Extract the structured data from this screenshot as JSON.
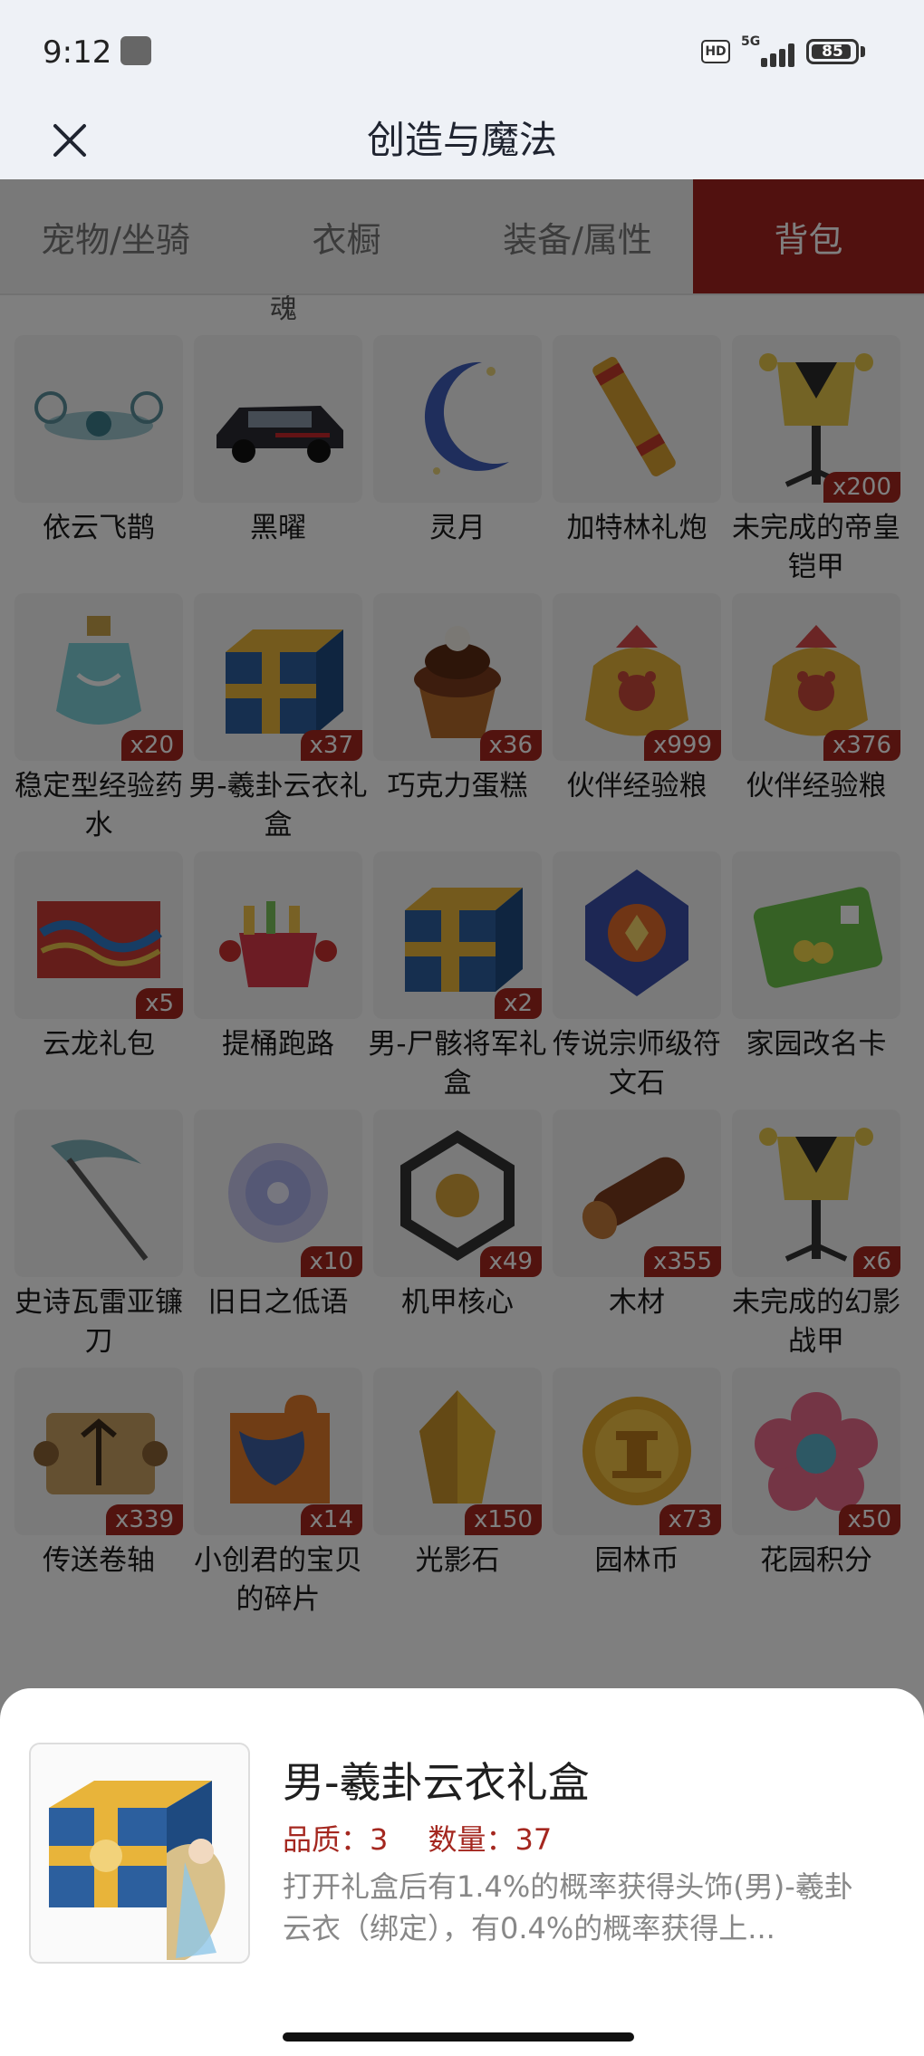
{
  "status": {
    "time": "9:12",
    "hd": "HD",
    "network": "5G",
    "battery": "85"
  },
  "header": {
    "title": "创造与魔法",
    "close_icon": "close-icon"
  },
  "tabs": [
    {
      "label": "宠物/坐骑",
      "active": false
    },
    {
      "label": "衣橱",
      "active": false
    },
    {
      "label": "装备/属性",
      "active": false
    },
    {
      "label": "背包",
      "active": true
    }
  ],
  "clipped_text": "魂",
  "items": [
    [
      {
        "name": "依云飞鹊",
        "badge": "",
        "icon": "drone-icon"
      },
      {
        "name": "黑曜",
        "badge": "",
        "icon": "car-icon"
      },
      {
        "name": "灵月",
        "badge": "",
        "icon": "crescent-moon-icon"
      },
      {
        "name": "加特林礼炮",
        "badge": "",
        "icon": "cannon-icon"
      },
      {
        "name": "未完成的帝皇铠甲",
        "badge": "x200",
        "icon": "armor-stand-icon"
      }
    ],
    [
      {
        "name": "稳定型经验药水",
        "badge": "x20",
        "icon": "potion-icon"
      },
      {
        "name": "男-羲卦云衣礼盒",
        "badge": "x37",
        "icon": "gift-box-icon"
      },
      {
        "name": "巧克力蛋糕",
        "badge": "x36",
        "icon": "cupcake-icon"
      },
      {
        "name": "伙伴经验粮",
        "badge": "x999",
        "icon": "food-bag-icon"
      },
      {
        "name": "伙伴经验粮",
        "badge": "x376",
        "icon": "food-bag-icon"
      }
    ],
    [
      {
        "name": "云龙礼包",
        "badge": "x5",
        "icon": "dragon-package-icon"
      },
      {
        "name": "提桶跑路",
        "badge": "",
        "icon": "bucket-icon"
      },
      {
        "name": "男-尸骸将军礼盒",
        "badge": "x2",
        "icon": "gift-box-icon"
      },
      {
        "name": "传说宗师级符文石",
        "badge": "",
        "icon": "rune-stone-icon"
      },
      {
        "name": "家园改名卡",
        "badge": "",
        "icon": "rename-card-icon"
      }
    ],
    [
      {
        "name": "史诗瓦雷亚镰刀",
        "badge": "",
        "icon": "scythe-icon"
      },
      {
        "name": "旧日之低语",
        "badge": "x10",
        "icon": "orb-icon"
      },
      {
        "name": "机甲核心",
        "badge": "x49",
        "icon": "mech-core-icon"
      },
      {
        "name": "木材",
        "badge": "x355",
        "icon": "log-icon"
      },
      {
        "name": "未完成的幻影战甲",
        "badge": "x6",
        "icon": "armor-stand-icon"
      }
    ],
    [
      {
        "name": "传送卷轴",
        "badge": "x339",
        "icon": "scroll-icon"
      },
      {
        "name": "小创君的宝贝的碎片",
        "badge": "x14",
        "icon": "puzzle-piece-icon"
      },
      {
        "name": "光影石",
        "badge": "x150",
        "icon": "crystal-icon"
      },
      {
        "name": "园林币",
        "badge": "x73",
        "icon": "coin-icon"
      },
      {
        "name": "花园积分",
        "badge": "x50",
        "icon": "flower-icon"
      }
    ]
  ],
  "detail": {
    "name": "男-羲卦云衣礼盒",
    "quality": "品质：3",
    "quantity": "数量：37",
    "description": "打开礼盒后有1.4%的概率获得头饰(男)-羲卦云衣（绑定），有0.4%的概率获得上..."
  },
  "colors": {
    "accent": "#a3231f",
    "badge": "#a4271f",
    "header_bg": "#eef1f6"
  }
}
